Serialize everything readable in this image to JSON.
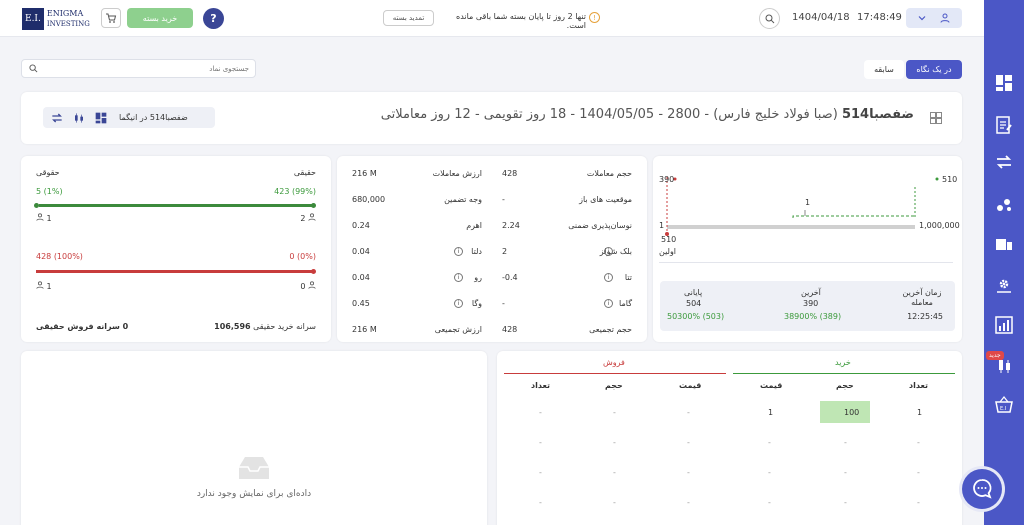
{
  "header": {
    "logo_line1": "E.I.",
    "logo_line2": "ENIGMA",
    "logo_line3": "INVESTING",
    "buy_package": "خرید بسته",
    "help": "?",
    "renew": "تمدید بسته",
    "notice": "تنها 2 روز تا پایان بسته شما باقی مانده است.",
    "date": "1404/04/18",
    "time": "17:48:49"
  },
  "tabs": {
    "overview": "در یک نگاه",
    "history": "سابقه"
  },
  "search": {
    "placeholder": "جستجوی نماد"
  },
  "title": {
    "symbol": "ضفصبا514",
    "details": "(صبا فولاد خلیج فارس) - 2800 - 1404/05/05 - 18 روز تقویمی - 12 روز معاملاتی",
    "tag": "ضفصبا514 در انیگما"
  },
  "legal_panel": {
    "real_label": "حقیقی",
    "legal_label": "حقوقی",
    "buy_real": "423 (99%)",
    "buy_legal": "5 (1%)",
    "buy_real_count": "2",
    "buy_legal_count": "1",
    "sell_real": "0 (0%)",
    "sell_legal": "428 (100%)",
    "sell_real_count": "0",
    "sell_legal_count": "1",
    "per_capita_buy_label": "سرانه خرید حقیقی",
    "per_capita_buy": "106,596",
    "per_capita_sell": "0 سرانه فروش حقیقی",
    "bar_buy_fill": 0.99,
    "bar_sell_fill": 1.0
  },
  "stats": {
    "right": [
      {
        "label": "حجم معاملات",
        "value": "428"
      },
      {
        "label": "موقعیت های باز",
        "value": "-"
      },
      {
        "label": "نوسان‌پذیری ضمنی",
        "value": "2.24"
      },
      {
        "label": "بلک شولز",
        "value": "2"
      },
      {
        "label": "تتا",
        "value": "-0.4"
      },
      {
        "label": "گاما",
        "value": "-"
      },
      {
        "label": "حجم تجمیعی",
        "value": "428"
      }
    ],
    "left": [
      {
        "label": "ارزش معاملات",
        "value": "216 M"
      },
      {
        "label": "وجه تضمین",
        "value": "680,000"
      },
      {
        "label": "اهرم",
        "value": "0.24"
      },
      {
        "label": "دلتا",
        "value": "0.04"
      },
      {
        "label": "رو",
        "value": "0.04"
      },
      {
        "label": "وگا",
        "value": "0.45"
      },
      {
        "label": "ارزش تجمیعی",
        "value": "216 M"
      }
    ]
  },
  "price_panel": {
    "high_left": "390",
    "high_right": "510",
    "low_left": "1",
    "low_right": "1,000,000",
    "mid": "1",
    "first_label": "اولین",
    "first_value": "510",
    "last_time_label": "زمان آخرین معامله",
    "last_time": "12:25:45",
    "last_label": "آخرین",
    "last_value": "390",
    "last_change": "38900% (389)",
    "close_label": "پایانی",
    "close_value": "504",
    "close_change": "50300% (503)"
  },
  "orderbook": {
    "buy_title": "خرید",
    "sell_title": "فروش",
    "buy_headers": [
      "تعداد",
      "حجم",
      "قیمت"
    ],
    "sell_headers": [
      "قیمت",
      "حجم",
      "تعداد"
    ],
    "first_row_buy": [
      "1",
      "100",
      "1"
    ],
    "dash": "-"
  },
  "trades": {
    "empty": "داده‌ای برای نمایش وجود ندارد"
  },
  "sidebar": {
    "new_badge": "جدید"
  },
  "colors": {
    "accent": "#4b57c6",
    "buy": "#3c9a3c",
    "sell": "#c83c3c",
    "buy_button": "#8ed08e"
  }
}
